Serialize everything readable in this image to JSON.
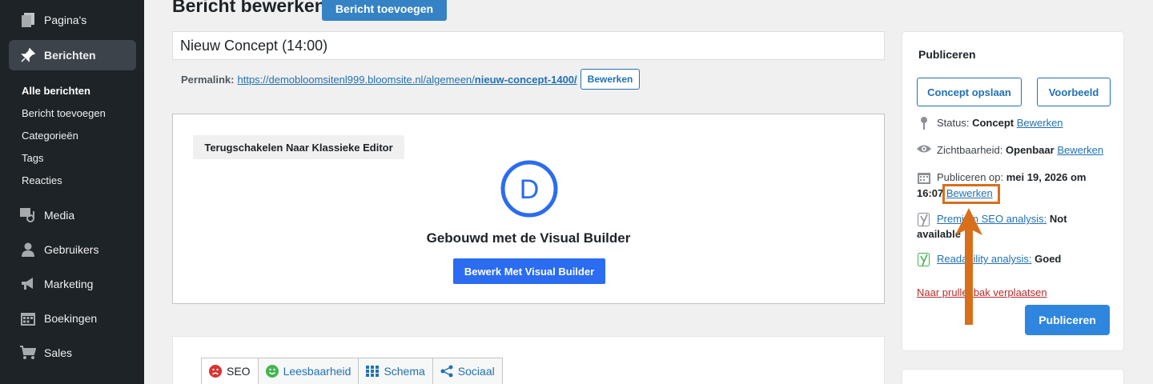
{
  "sidebar": {
    "items": [
      {
        "label": "Pagina's",
        "icon": "pages-icon"
      },
      {
        "label": "Berichten",
        "icon": "pin-icon"
      },
      {
        "label": "Media",
        "icon": "media-icon"
      },
      {
        "label": "Gebruikers",
        "icon": "user-icon"
      },
      {
        "label": "Marketing",
        "icon": "megaphone-icon"
      },
      {
        "label": "Boekingen",
        "icon": "calendar-icon"
      },
      {
        "label": "Sales",
        "icon": "cart-icon"
      }
    ],
    "subitems": [
      "Alle berichten",
      "Bericht toevoegen",
      "Categorieën",
      "Tags",
      "Reacties"
    ]
  },
  "header": {
    "title": "Bericht bewerken",
    "add_label": "Bericht toevoegen"
  },
  "post": {
    "title": "Nieuw Concept (14:00)",
    "permalink_label": "Permalink:",
    "permalink_base": "https://demobloomsitenl999.bloomsite.nl/algemeen/",
    "permalink_slug": "nieuw-concept-1400/",
    "permalink_edit": "Bewerken"
  },
  "builder": {
    "switch_label": "Terugschakelen Naar Klassieke Editor",
    "logo_letter": "D",
    "title": "Gebouwd met de Visual Builder",
    "button_label": "Bewerk Met Visual Builder"
  },
  "yoast": {
    "tabs": [
      "SEO",
      "Leesbaarheid",
      "Schema",
      "Sociaal"
    ]
  },
  "publish": {
    "title": "Publiceren",
    "save_draft": "Concept opslaan",
    "preview": "Voorbeeld",
    "status_label": "Status:",
    "status_value": "Concept",
    "status_edit": "Bewerken",
    "visibility_label": "Zichtbaarheid:",
    "visibility_value": "Openbaar",
    "visibility_edit": "Bewerken",
    "date_label": "Publiceren op:",
    "date_value_1": "mei 19, 2026 om",
    "date_value_2": "16:07",
    "date_edit": "Bewerken",
    "seo_link": "Premium SEO analysis:",
    "seo_value_1": "Not",
    "seo_value_2": "available",
    "readability_link": "Readability analysis:",
    "readability_value": "Goed",
    "trash": "Naar prullenbak verplaatsen",
    "publish_button": "Publiceren"
  },
  "colors": {
    "sidebar_bg": "#1d2327",
    "accent": "#2271b1",
    "annotation": "#d86f1b"
  }
}
